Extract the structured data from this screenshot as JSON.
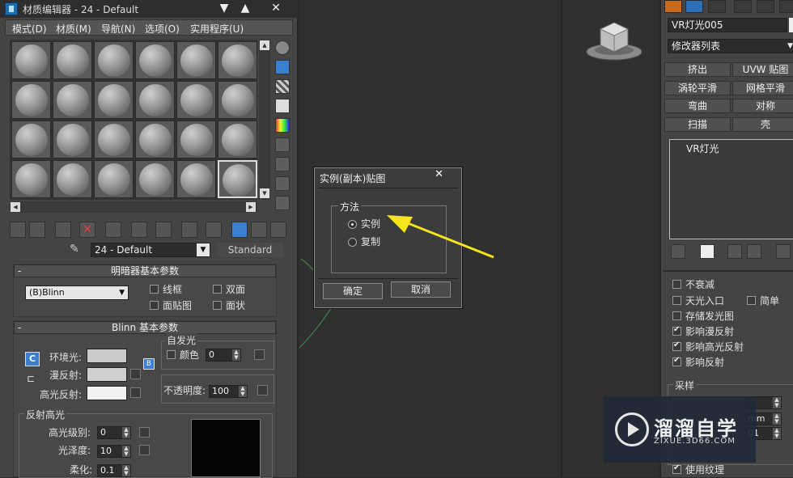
{
  "material_editor": {
    "title": "材质编辑器 - 24 - Default",
    "window_controls": [
      "▼",
      "▲",
      "✕"
    ],
    "menu": [
      "模式(D)",
      "材质(M)",
      "导航(N)",
      "选项(O)",
      "实用程序(U)"
    ],
    "slot_rows": 4,
    "slot_cols": 6,
    "active_slot": 24,
    "material_name": "24 - Default",
    "material_type": "Standard",
    "shader_rollout": {
      "title": "明暗器基本参数",
      "shader": "(B)Blinn",
      "options": [
        {
          "label": "线框",
          "checked": false
        },
        {
          "label": "双面",
          "checked": false
        },
        {
          "label": "面贴图",
          "checked": false
        },
        {
          "label": "面状",
          "checked": false
        }
      ]
    },
    "blinn_rollout": {
      "title": "Blinn 基本参数",
      "ambient_label": "环境光:",
      "diffuse_label": "漫反射:",
      "specular_label": "高光反射:",
      "self_illum_group": "自发光",
      "color_label": "颜色",
      "color_value": "0",
      "opacity_label": "不透明度:",
      "opacity_value": "100",
      "lock_letter": "C",
      "map_letter": "B"
    },
    "specular_group": {
      "title": "反射高光",
      "level_label": "高光级别:",
      "level_value": "0",
      "gloss_label": "光泽度:",
      "gloss_value": "10",
      "soften_label": "柔化:",
      "soften_value": "0.1"
    }
  },
  "dialog": {
    "title": "实例(副本)贴图",
    "group_title": "方法",
    "options": [
      {
        "label": "实例",
        "selected": true
      },
      {
        "label": "复制",
        "selected": false
      }
    ],
    "ok": "确定",
    "cancel": "取消"
  },
  "command_panel": {
    "object_name": "VR灯光005",
    "modifier_list": "修改器列表",
    "buttons": [
      "挤出",
      "UVW 贴图",
      "涡轮平滑",
      "网格平滑",
      "弯曲",
      "对称",
      "扫描",
      "壳"
    ],
    "stack_item": "VR灯光",
    "options": [
      {
        "label": "不衰减",
        "checked": false
      },
      {
        "label": "天光入口",
        "checked": false
      },
      {
        "label": "简单",
        "checked": false
      },
      {
        "label": "存储发光图",
        "checked": false
      },
      {
        "label": "影响漫反射",
        "checked": true
      },
      {
        "label": "影响高光反射",
        "checked": true
      },
      {
        "label": "影响反射",
        "checked": true
      }
    ],
    "sampling_label": "采样",
    "sampling_partial": [
      "mm",
      "01"
    ],
    "use_texture": {
      "label": "使用纹理",
      "checked": true
    }
  },
  "watermark": {
    "title": "溜溜自学",
    "subtitle": "ZIXUE.3D66.COM"
  }
}
